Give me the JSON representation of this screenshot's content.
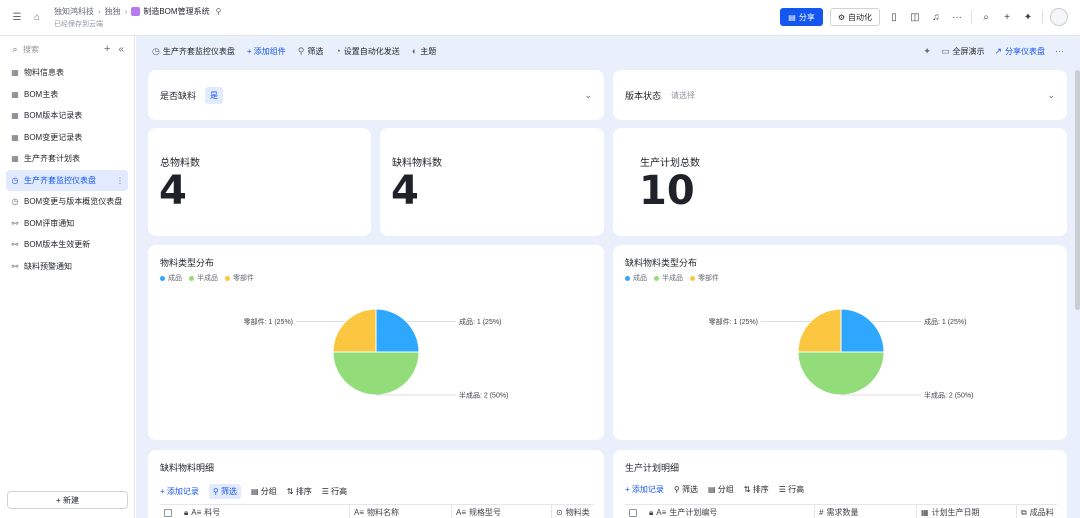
{
  "header": {
    "breadcrumb": [
      "独知鸿科技",
      "独独",
      "制造BOM管理系统"
    ],
    "saved_status": "已经保存到云端",
    "share_label": "分享",
    "automation_label": "自动化"
  },
  "sidebar": {
    "search_placeholder": "搜索",
    "items": [
      {
        "label": "物料信息表",
        "icon": "table-icon"
      },
      {
        "label": "BOM主表",
        "icon": "table-icon"
      },
      {
        "label": "BOM版本记录表",
        "icon": "table-icon"
      },
      {
        "label": "BOM变更记录表",
        "icon": "table-icon"
      },
      {
        "label": "生产齐套计划表",
        "icon": "table-icon"
      },
      {
        "label": "生产齐套监控仪表盘",
        "icon": "dashboard-icon",
        "active": true
      },
      {
        "label": "BOM变更与版本概览仪表盘",
        "icon": "dashboard-icon"
      },
      {
        "label": "BOM评审通知",
        "icon": "workflow-icon"
      },
      {
        "label": "BOM版本生效更新",
        "icon": "workflow-icon"
      },
      {
        "label": "缺料预警通知",
        "icon": "workflow-icon"
      }
    ],
    "new_label": "+ 新建"
  },
  "dashboard": {
    "title": "生产齐套监控仪表盘",
    "add_widget": "+ 添加组件",
    "filter": "筛选",
    "auto_send": "设置自动化发送",
    "theme": "主题",
    "fullscreen": "全屏演示",
    "share_dashboard": "分享仪表盘"
  },
  "filters": {
    "shortage_label": "是否缺料",
    "shortage_value": "是",
    "version_label": "版本状态",
    "version_placeholder": "请选择"
  },
  "stats": [
    {
      "label": "总物料数",
      "value": "4"
    },
    {
      "label": "缺料物料数",
      "value": "4"
    },
    {
      "label": "生产计划总数",
      "value": "10"
    }
  ],
  "colors": {
    "blue": "#2ea7ff",
    "green": "#92dd7a",
    "yellow": "#fcc740"
  },
  "chart_data": [
    {
      "type": "pie",
      "title": "物料类型分布",
      "legend": [
        "成品",
        "半成品",
        "零部件"
      ],
      "slices": [
        {
          "name": "成品",
          "value": 1,
          "percent": 25,
          "label": "成品: 1 (25%)"
        },
        {
          "name": "半成品",
          "value": 2,
          "percent": 50,
          "label": "半成品: 2 (50%)"
        },
        {
          "name": "零部件",
          "value": 1,
          "percent": 25,
          "label": "零部件: 1 (25%)"
        }
      ]
    },
    {
      "type": "pie",
      "title": "缺料物料类型分布",
      "legend": [
        "成品",
        "半成品",
        "零部件"
      ],
      "slices": [
        {
          "name": "成品",
          "value": 1,
          "percent": 25,
          "label": "成品: 1 (25%)"
        },
        {
          "name": "半成品",
          "value": 2,
          "percent": 50,
          "label": "半成品: 2 (50%)"
        },
        {
          "name": "零部件",
          "value": 1,
          "percent": 25,
          "label": "零部件: 1 (25%)"
        }
      ]
    }
  ],
  "tables": [
    {
      "title": "缺料物料明细",
      "toolbar": [
        "+ 添加记录",
        "筛选",
        "分组",
        "排序",
        "行高"
      ],
      "columns": [
        "料号",
        "物料名称",
        "规格型号",
        "物料类"
      ]
    },
    {
      "title": "生产计划明细",
      "toolbar": [
        "+ 添加记录",
        "筛选",
        "分组",
        "排序",
        "行高"
      ],
      "columns": [
        "生产计划编号",
        "需求数量",
        "计划生产日期",
        "成品料"
      ]
    }
  ]
}
